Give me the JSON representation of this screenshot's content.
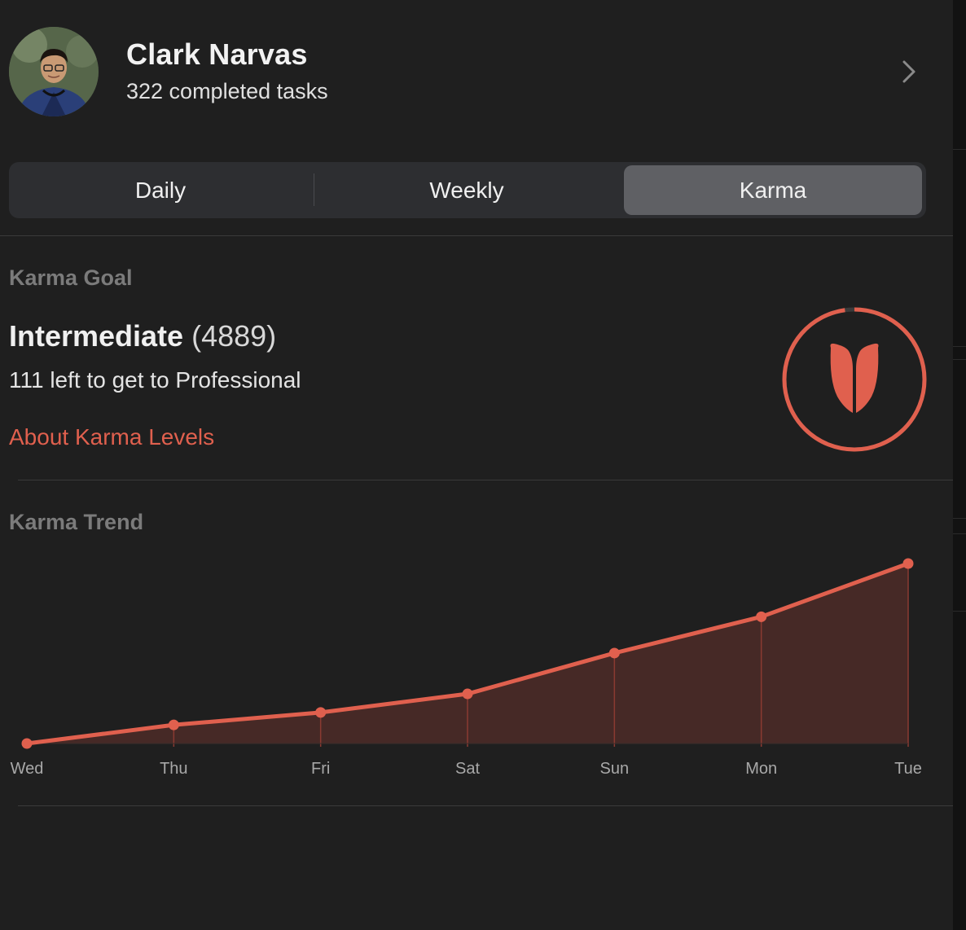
{
  "profile": {
    "name": "Clark Narvas",
    "completed_tasks": "322 completed tasks"
  },
  "tabs": [
    {
      "label": "Daily",
      "active": false
    },
    {
      "label": "Weekly",
      "active": false
    },
    {
      "label": "Karma",
      "active": true
    }
  ],
  "karma_goal": {
    "section_title": "Karma Goal",
    "level": "Intermediate",
    "points": "(4889)",
    "remaining": "111 left to get to Professional",
    "about_link": "About Karma Levels",
    "progress_fraction": 0.978,
    "icon": "karma-logo-icon"
  },
  "karma_trend": {
    "section_title": "Karma Trend"
  },
  "colors": {
    "accent": "#e0604e",
    "background": "#1f1f1f",
    "segment_bg": "#2d2e31",
    "segment_active": "#5f6064",
    "area_fill": "#4a2a27"
  },
  "chart_data": {
    "type": "area",
    "categories": [
      "Wed",
      "Thu",
      "Fri",
      "Sat",
      "Sun",
      "Mon",
      "Tue"
    ],
    "series": [
      {
        "values": [
          4686,
          4707,
          4721,
          4742,
          4788,
          4829,
          4889
        ]
      }
    ],
    "ylim": [
      4686,
      4889
    ],
    "grid": false,
    "legend": "none"
  }
}
